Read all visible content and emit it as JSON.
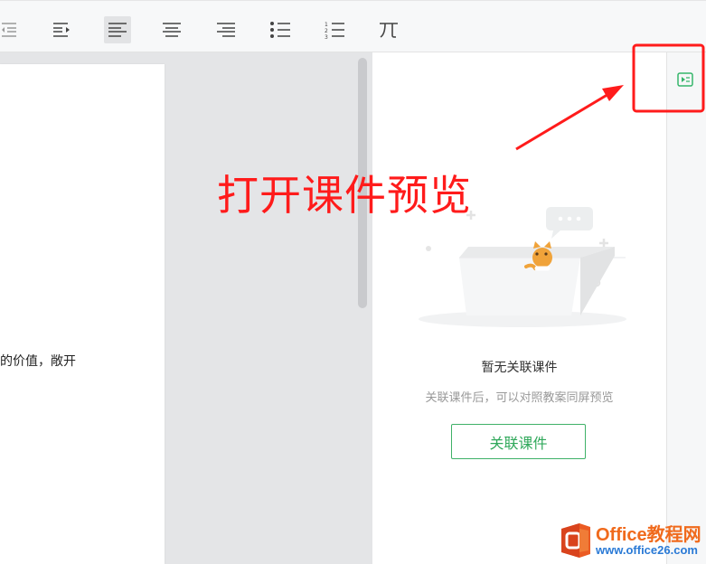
{
  "document": {
    "body_text": "的价值，敞开"
  },
  "courseware_panel": {
    "empty_title": "暂无关联课件",
    "empty_description": "关联课件后，可以对照教案同屏预览",
    "link_button_label": "关联课件"
  },
  "annotation": {
    "text": "打开课件预览",
    "color": "#ff1b1b"
  },
  "watermark": {
    "title": "Office教程网",
    "url": "www.office26.com"
  },
  "colors": {
    "accent": "#3fb168",
    "annotation_red": "#ff1b1b"
  },
  "toolbar": {
    "icons": [
      "decrease-indent-icon",
      "increase-indent-icon",
      "align-left-icon",
      "align-center-icon",
      "align-right-icon",
      "bullet-list-icon",
      "numbered-list-icon",
      "distribute-icon"
    ]
  }
}
